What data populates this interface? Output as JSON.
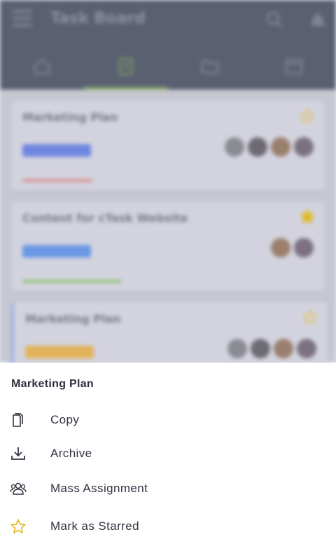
{
  "app": {
    "title": "Task Board",
    "top_icons": [
      "menu-icon",
      "search-icon",
      "bell-icon"
    ],
    "tabs": [
      {
        "icon": "home-icon",
        "active": false
      },
      {
        "icon": "board-icon",
        "active": true
      },
      {
        "icon": "folder-icon",
        "active": false
      },
      {
        "icon": "calendar-icon",
        "active": false
      }
    ],
    "accent_color": "#7aa35a"
  },
  "background_cards": [
    {
      "title": "Marketing Plan",
      "tag_color": "#6f86e0",
      "starred": false,
      "bar_color": "#d98a8a",
      "avatar_count": 4
    },
    {
      "title": "Content for cTask Website",
      "tag_color": "#6a98e4",
      "starred": true,
      "bar_color": "#8cc36f",
      "avatar_count": 2
    },
    {
      "title": "Marketing Plan",
      "tag_color": "#e2b25a",
      "starred": false,
      "bar_color": "#c8c8d0",
      "avatar_count": 4
    }
  ],
  "sheet": {
    "title": "Marketing Plan",
    "items": [
      {
        "label": "Copy",
        "icon": "copy-icon"
      },
      {
        "label": "Archive",
        "icon": "archive-download-icon"
      },
      {
        "label": "Mass Assignment",
        "icon": "group-users-icon"
      },
      {
        "label": "Mark as Starred",
        "icon": "star-outline-icon",
        "icon_color": "#e0b91c"
      }
    ]
  }
}
